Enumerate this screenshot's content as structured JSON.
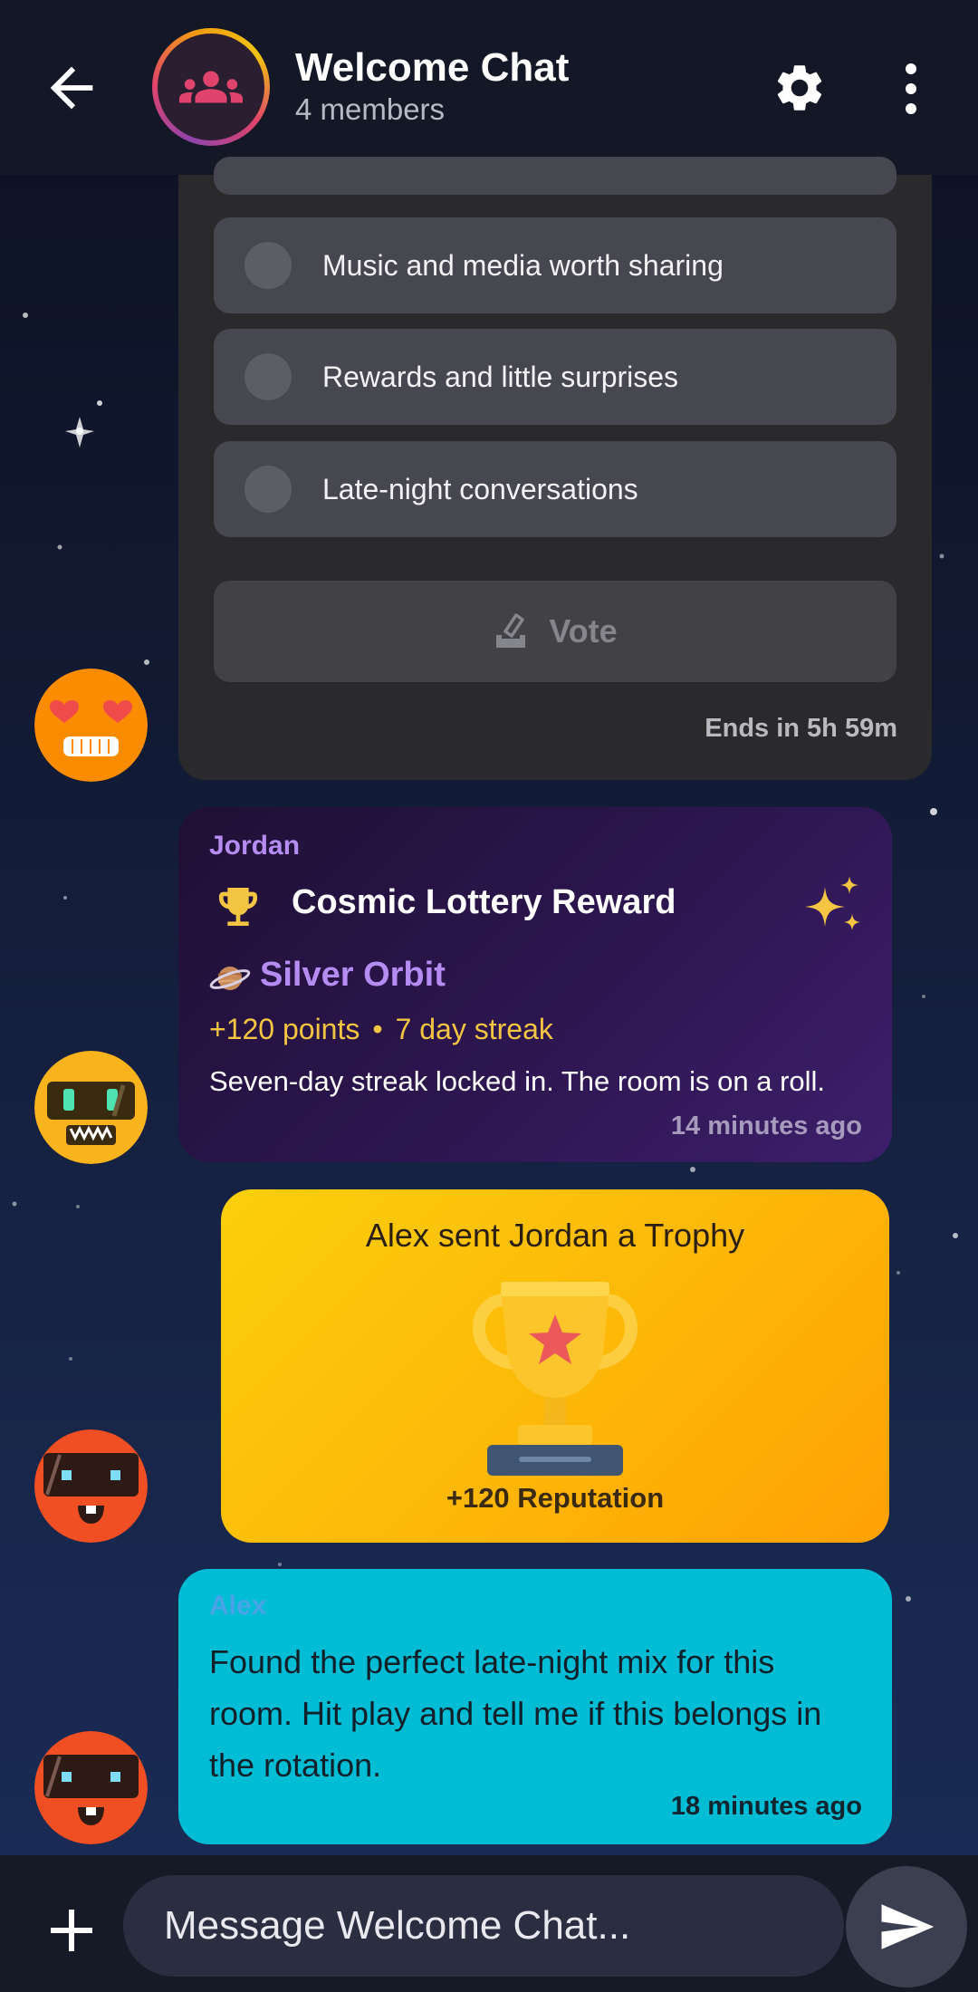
{
  "header": {
    "back_icon": "arrow-left-icon",
    "group_icon": "group-icon",
    "title": "Welcome Chat",
    "subtitle": "4 members",
    "settings_icon": "gear-icon",
    "more_icon": "more-vertical-icon"
  },
  "poll": {
    "options": [
      {
        "label": "Music and media worth sharing"
      },
      {
        "label": "Rewards and little surprises"
      },
      {
        "label": "Late-night conversations"
      }
    ],
    "vote_label": "Vote",
    "vote_icon": "ballot-icon",
    "ends_text": "Ends in 5h 59m"
  },
  "reward": {
    "sender": "Jordan",
    "title": "Cosmic Lottery Reward",
    "tier": "Silver Orbit",
    "points": "+120 points",
    "streak": "7 day streak",
    "separator": "•",
    "message": "Seven-day streak locked in. The room is on a roll.",
    "time": "14 minutes ago",
    "accent_color": "#b48cf2",
    "gold_color": "#f4c542"
  },
  "gift": {
    "title": "Alex sent Jordan a Trophy",
    "reputation": "+120 Reputation"
  },
  "message": {
    "sender": "Alex",
    "text": "Found the perfect late-night mix for this room. Hit play and tell me if this belongs in the rotation.",
    "time": "18 minutes ago",
    "bubble_color": "#00bcd4"
  },
  "composer": {
    "placeholder": "Message Welcome Chat...",
    "add_icon": "plus-icon",
    "send_icon": "send-icon"
  }
}
